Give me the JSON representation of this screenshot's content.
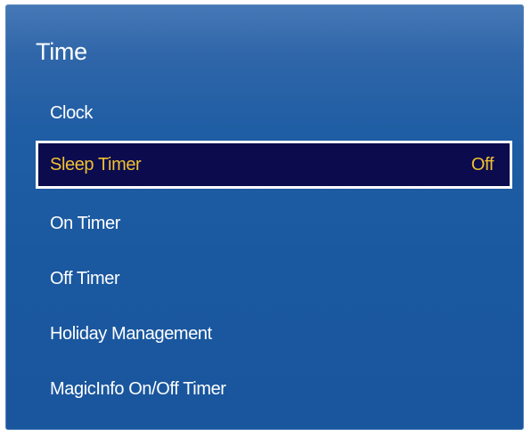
{
  "menu": {
    "title": "Time",
    "items": [
      {
        "label": "Clock",
        "value": ""
      },
      {
        "label": "Sleep Timer",
        "value": "Off",
        "selected": true
      },
      {
        "label": "On Timer",
        "value": ""
      },
      {
        "label": "Off Timer",
        "value": ""
      },
      {
        "label": "Holiday Management",
        "value": ""
      },
      {
        "label": "MagicInfo On/Off Timer",
        "value": ""
      }
    ]
  },
  "colors": {
    "panel_background": "#1f5da4",
    "selected_background": "#0b0b4e",
    "selected_text": "#f0c030",
    "selected_border": "#ffffff",
    "text": "#ffffff"
  }
}
